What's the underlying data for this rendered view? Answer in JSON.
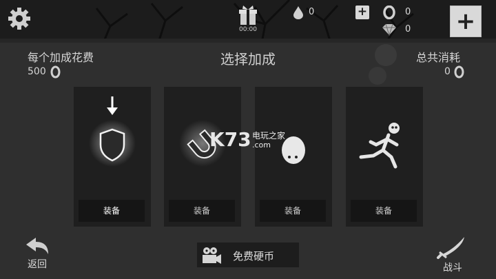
{
  "header": {
    "gift_timer": "00:00",
    "drops_count": "0",
    "rings_count": "0",
    "gems_count": "0"
  },
  "cost": {
    "label": "每个加成花费",
    "value": "500"
  },
  "title": "选择加成",
  "total": {
    "label": "总共消耗",
    "value": "0"
  },
  "boosts": [
    {
      "icon": "shield-icon",
      "equip_label": "装备",
      "selected": true
    },
    {
      "icon": "magnet-icon",
      "equip_label": "装备",
      "selected": false
    },
    {
      "icon": "blob-icon",
      "equip_label": "装备",
      "selected": false
    },
    {
      "icon": "runner-icon",
      "equip_label": "装备",
      "selected": false
    }
  ],
  "footer": {
    "back_label": "返回",
    "free_coins_label": "免费硬币",
    "battle_label": "战斗"
  },
  "watermark": {
    "brand": "K73",
    "line1": "电玩之家",
    "line2": ".com"
  },
  "colors": {
    "background": "#2f2f2f",
    "card": "#1f1f1f",
    "button": "#151515",
    "plus_button": "#d9d9d9"
  }
}
